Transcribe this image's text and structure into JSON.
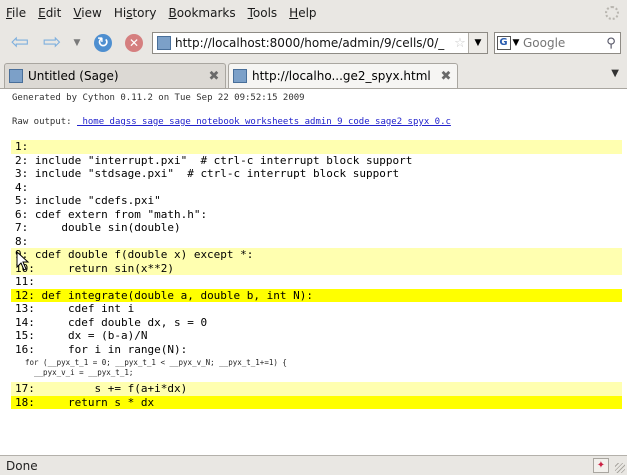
{
  "menu": {
    "items": [
      {
        "mn": "F",
        "rest": "ile"
      },
      {
        "mn": "E",
        "rest": "dit"
      },
      {
        "mn": "V",
        "rest": "iew"
      },
      {
        "pre": "Hi",
        "mn": "s",
        "rest": "tory"
      },
      {
        "mn": "B",
        "rest": "ookmarks"
      },
      {
        "mn": "T",
        "rest": "ools"
      },
      {
        "mn": "H",
        "rest": "elp"
      }
    ]
  },
  "toolbar": {
    "url": "http://localhost:8000/home/admin/9/cells/0/_",
    "search_placeholder": "Google",
    "icons": {
      "back": "back-arrow-icon",
      "forward": "forward-arrow-icon",
      "reload": "reload-icon",
      "stop": "stop-icon",
      "bookmark": "star-icon",
      "search": "magnifier-icon"
    }
  },
  "tabs": [
    {
      "title": "Untitled (Sage)",
      "active": false
    },
    {
      "title": "http://localho...ge2_spyx.html",
      "active": true
    }
  ],
  "page": {
    "generated": "Generated by Cython 0.11.2 on Tue Sep 22 09:52:15 2009",
    "raw_label": "Raw output:",
    "raw_link": "_home_dagss_sage_sage_notebook_worksheets_admin_9_code_sage2_spyx_0.c",
    "code_lines": [
      {
        "num": "1:",
        "code": "",
        "hl": "pale"
      },
      {
        "num": "2:",
        "code": "include \"interrupt.pxi\"  # ctrl-c interrupt block support",
        "hl": ""
      },
      {
        "num": "3:",
        "code": "include \"stdsage.pxi\"  # ctrl-c interrupt block support",
        "hl": ""
      },
      {
        "num": "4:",
        "code": "",
        "hl": ""
      },
      {
        "num": "5:",
        "code": "include \"cdefs.pxi\"",
        "hl": ""
      },
      {
        "num": "6:",
        "code": "cdef extern from \"math.h\":",
        "hl": ""
      },
      {
        "num": "7:",
        "code": "    double sin(double)",
        "hl": ""
      },
      {
        "num": "8:",
        "code": "",
        "hl": ""
      },
      {
        "num": "9:",
        "code": "cdef double f(double x) except *:",
        "hl": "pale"
      },
      {
        "num": "10:",
        "code": "    return sin(x**2)",
        "hl": "pale"
      },
      {
        "num": "11:",
        "code": "",
        "hl": ""
      },
      {
        "num": "12:",
        "code": "def integrate(double a, double b, int N):",
        "hl": "bright"
      },
      {
        "num": "13:",
        "code": "    cdef int i",
        "hl": ""
      },
      {
        "num": "14:",
        "code": "    cdef double dx, s = 0",
        "hl": ""
      },
      {
        "num": "15:",
        "code": "    dx = (b-a)/N",
        "hl": ""
      },
      {
        "num": "16:",
        "code": "    for i in range(N):",
        "hl": ""
      }
    ],
    "c_code": "for (__pyx_t_1 = 0; __pyx_t_1 < __pyx_v_N; __pyx_t_1+=1) {\n  __pyx_v_i = __pyx_t_1;",
    "code_lines_after": [
      {
        "num": "17:",
        "code": "        s += f(a+i*dx)",
        "hl": "pale"
      },
      {
        "num": "18:",
        "code": "    return s * dx",
        "hl": "bright"
      }
    ]
  },
  "status": {
    "text": "Done"
  },
  "colors": {
    "pale_highlight": "#ffffb0",
    "bright_highlight": "#ffff00",
    "link": "#2222cc"
  }
}
